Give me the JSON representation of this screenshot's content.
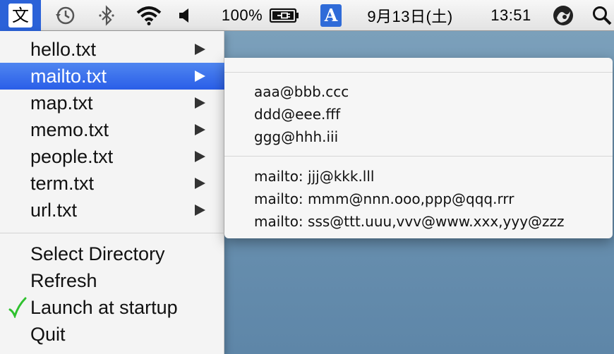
{
  "menubar": {
    "app_icon_glyph": "文",
    "battery": "100%",
    "input_source_glyph": "A",
    "date": "9月13日(土)",
    "time": "13:51",
    "icons": [
      "time-machine-icon",
      "bluetooth-icon",
      "wifi-icon",
      "volume-icon",
      "battery-plug-icon",
      "input-source-icon",
      "user-icon",
      "spotlight-icon"
    ]
  },
  "menu": {
    "files": [
      {
        "label": "hello.txt"
      },
      {
        "label": "mailto.txt"
      },
      {
        "label": "map.txt"
      },
      {
        "label": "memo.txt"
      },
      {
        "label": "people.txt"
      },
      {
        "label": "term.txt"
      },
      {
        "label": "url.txt"
      }
    ],
    "selected_file": "mailto.txt",
    "actions": [
      {
        "label": "Select Directory"
      },
      {
        "label": "Refresh"
      },
      {
        "label": "Launch at startup",
        "checked": true
      },
      {
        "label": "Quit"
      }
    ]
  },
  "submenu": {
    "group1": [
      "aaa@bbb.ccc",
      "ddd@eee.fff",
      "ggg@hhh.iii"
    ],
    "group2": [
      "mailto: jjj@kkk.lll",
      "mailto: mmm@nnn.ooo,ppp@qqq.rrr",
      "mailto: sss@ttt.uuu,vvv@www.xxx,yyy@zzz"
    ]
  },
  "colors": {
    "selection": "#2a5ee8",
    "checkmark": "#2fc12f",
    "desktop": "#6e95b3"
  }
}
